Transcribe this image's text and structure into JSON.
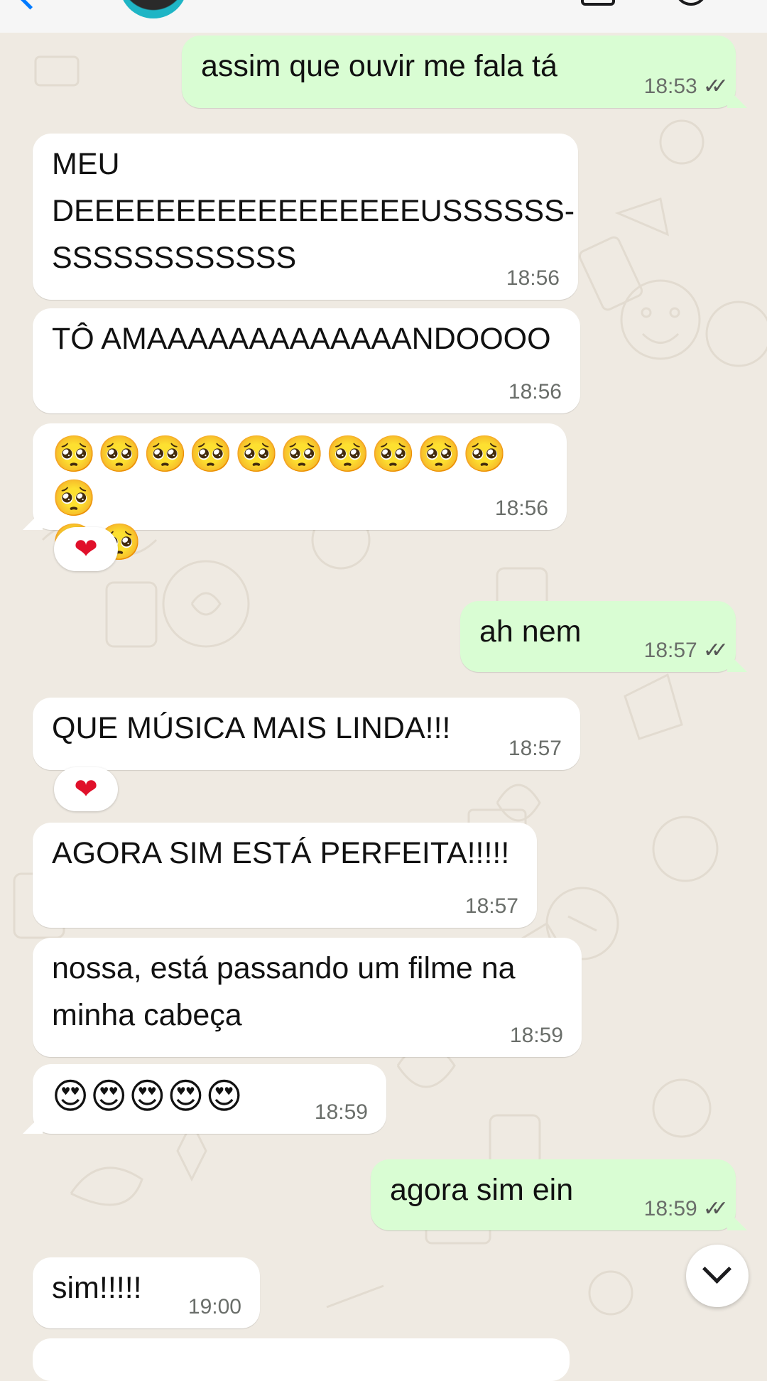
{
  "messages": [
    {
      "text": "assim que ouvir me fala tá",
      "time": "18:53",
      "status": "✓✓"
    },
    {
      "text": "MEU\nDEEEEEEEEEEEEEEEEEUSSSSSS-\nSSSSSSSSSSSS",
      "time": "18:56"
    },
    {
      "text": "TÔ AMAAAAAAAAAAAAANDOOOO",
      "time": "18:56"
    },
    {
      "text": "🥺🥺🥺🥺🥺🥺🥺🥺🥺🥺🥺\n🥺🥺",
      "time": "18:56",
      "reaction": "❤"
    },
    {
      "text": "ah nem",
      "time": "18:57",
      "status": "✓✓"
    },
    {
      "text": "QUE MÚSICA MAIS LINDA!!!",
      "time": "18:57",
      "reaction": "❤"
    },
    {
      "text": "AGORA SIM ESTÁ PERFEITA!!!!!",
      "time": "18:57"
    },
    {
      "text": "nossa, está passando um filme na\nminha cabeça",
      "time": "18:59"
    },
    {
      "text": "😍😍😍😍😍",
      "time": "18:59"
    },
    {
      "text": "agora sim ein",
      "time": "18:59",
      "status": "✓✓"
    },
    {
      "text": "sim!!!!!",
      "time": "19:00"
    }
  ],
  "icons": {
    "back": "chevron-left-icon",
    "video": "video-call-icon",
    "call": "phone-icon",
    "scroll": "chevron-down-icon",
    "read": "double-check-icon",
    "reaction": "red-heart-icon"
  },
  "colors": {
    "background": "#efeae2",
    "incoming": "#ffffff",
    "outgoing": "#d9fdd3",
    "timestamp": "#6a6e6a",
    "heart": "#e0102a"
  }
}
